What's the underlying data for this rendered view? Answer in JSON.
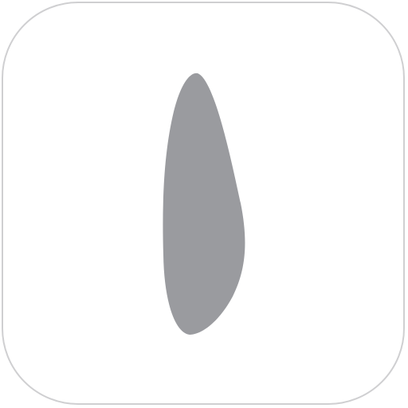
{
  "icon": {
    "name": "drop-blade-icon",
    "tile_background": "#ffffff",
    "tile_border_color": "#cfcfd1",
    "glyph_color": "#9a9b9f"
  }
}
